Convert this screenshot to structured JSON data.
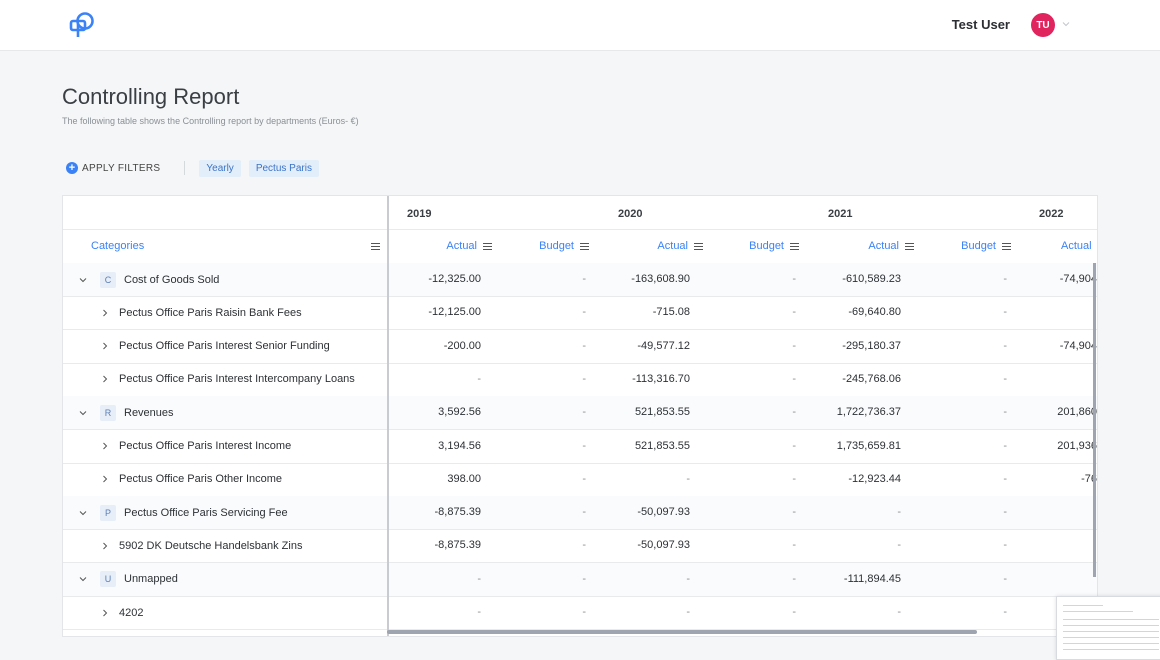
{
  "header": {
    "user_name": "Test User",
    "avatar_initials": "TU",
    "brand_color": "#3b82f6",
    "avatar_color": "#e0245e"
  },
  "page": {
    "title": "Controlling Report",
    "subtitle": "The following table shows the Controlling report by departments (Euros- €)"
  },
  "filters": {
    "apply_label": "APPLY FILTERS",
    "chips": [
      "Yearly",
      "Pectus Paris"
    ]
  },
  "table": {
    "categories_header": "Categories",
    "years": [
      "2019",
      "2020",
      "2021",
      "2022"
    ],
    "actual_label": "Actual",
    "budget_label": "Budget",
    "rows": [
      {
        "type": "group",
        "badge": "C",
        "label": "Cost of Goods Sold",
        "v": [
          "-12,325.00",
          "-",
          "-163,608.90",
          "-",
          "-610,589.23",
          "-",
          "-74,904"
        ]
      },
      {
        "type": "child",
        "label": "Pectus Office Paris Raisin Bank Fees",
        "v": [
          "-12,125.00",
          "-",
          "-715.08",
          "-",
          "-69,640.80",
          "-",
          ""
        ]
      },
      {
        "type": "child",
        "label": "Pectus Office Paris Interest Senior Funding",
        "v": [
          "-200.00",
          "-",
          "-49,577.12",
          "-",
          "-295,180.37",
          "-",
          "-74,904"
        ]
      },
      {
        "type": "child",
        "label": "Pectus Office Paris Interest Intercompany Loans",
        "v": [
          "-",
          "-",
          "-113,316.70",
          "-",
          "-245,768.06",
          "-",
          ""
        ]
      },
      {
        "type": "group",
        "badge": "R",
        "label": "Revenues",
        "v": [
          "3,592.56",
          "-",
          "521,853.55",
          "-",
          "1,722,736.37",
          "-",
          "201,860"
        ]
      },
      {
        "type": "child",
        "label": "Pectus Office Paris Interest Income",
        "v": [
          "3,194.56",
          "-",
          "521,853.55",
          "-",
          "1,735,659.81",
          "-",
          "201,936"
        ]
      },
      {
        "type": "child",
        "label": "Pectus Office Paris Other Income",
        "v": [
          "398.00",
          "-",
          "-",
          "-",
          "-12,923.44",
          "-",
          "-76"
        ]
      },
      {
        "type": "group",
        "badge": "P",
        "label": "Pectus Office Paris Servicing Fee",
        "v": [
          "-8,875.39",
          "-",
          "-50,097.93",
          "-",
          "-",
          "-",
          ""
        ]
      },
      {
        "type": "child",
        "label": "5902 DK Deutsche Handelsbank Zins",
        "v": [
          "-8,875.39",
          "-",
          "-50,097.93",
          "-",
          "-",
          "-",
          ""
        ]
      },
      {
        "type": "group",
        "badge": "U",
        "label": "Unmapped",
        "v": [
          "-",
          "-",
          "-",
          "-",
          "-111,894.45",
          "-",
          ""
        ]
      },
      {
        "type": "child",
        "label": "4202",
        "v": [
          "-",
          "-",
          "-",
          "-",
          "-",
          "-",
          ""
        ]
      }
    ]
  }
}
